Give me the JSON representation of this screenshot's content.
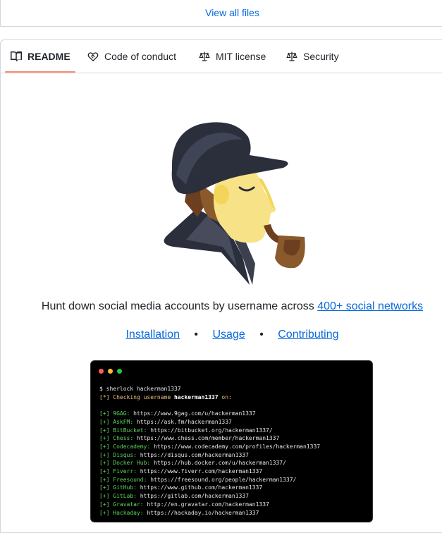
{
  "files": {
    "view_all_label": "View all files"
  },
  "tabs": [
    {
      "label": "README",
      "icon": "book-icon"
    },
    {
      "label": "Code of conduct",
      "icon": "heart-handshake-icon"
    },
    {
      "label": "MIT license",
      "icon": "law-scale-icon"
    },
    {
      "label": "Security",
      "icon": "law-scale-icon"
    }
  ],
  "readme": {
    "tagline_prefix": "Hunt down social media accounts by username across ",
    "tagline_link": "400+ social networks",
    "links": [
      "Installation",
      "Usage",
      "Contributing"
    ],
    "separator": "•"
  },
  "terminal": {
    "command": "$ sherlock hackerman1337",
    "checking_prefix": "[*] Checking username ",
    "checking_user": "hackerman1337",
    "checking_suffix": " on:",
    "results": [
      {
        "site": "9GAG",
        "url": "https://www.9gag.com/u/hackerman1337"
      },
      {
        "site": "AskFM",
        "url": "https://ask.fm/hackerman1337"
      },
      {
        "site": "BitBucket",
        "url": "https://bitbucket.org/hackerman1337/"
      },
      {
        "site": "Chess",
        "url": "https://www.chess.com/member/hackerman1337"
      },
      {
        "site": "Codecademy",
        "url": "https://www.codecademy.com/profiles/hackerman1337"
      },
      {
        "site": "Disqus",
        "url": "https://disqus.com/hackerman1337"
      },
      {
        "site": "Docker Hub",
        "url": "https://hub.docker.com/u/hackerman1337/"
      },
      {
        "site": "Fiverr",
        "url": "https://www.fiverr.com/hackerman1337"
      },
      {
        "site": "Freesound",
        "url": "https://freesound.org/people/hackerman1337/"
      },
      {
        "site": "GitHub",
        "url": "https://www.github.com/hackerman1337"
      },
      {
        "site": "GitLab",
        "url": "https://gitlab.com/hackerman1337"
      },
      {
        "site": "Gravatar",
        "url": "http://en.gravatar.com/hackerman1337"
      },
      {
        "site": "Hackaday",
        "url": "https://hackaday.io/hackerman1337"
      }
    ]
  },
  "colors": {
    "link": "#0969da",
    "tab_underline": "#fd8c73",
    "border": "#d0d7de"
  }
}
